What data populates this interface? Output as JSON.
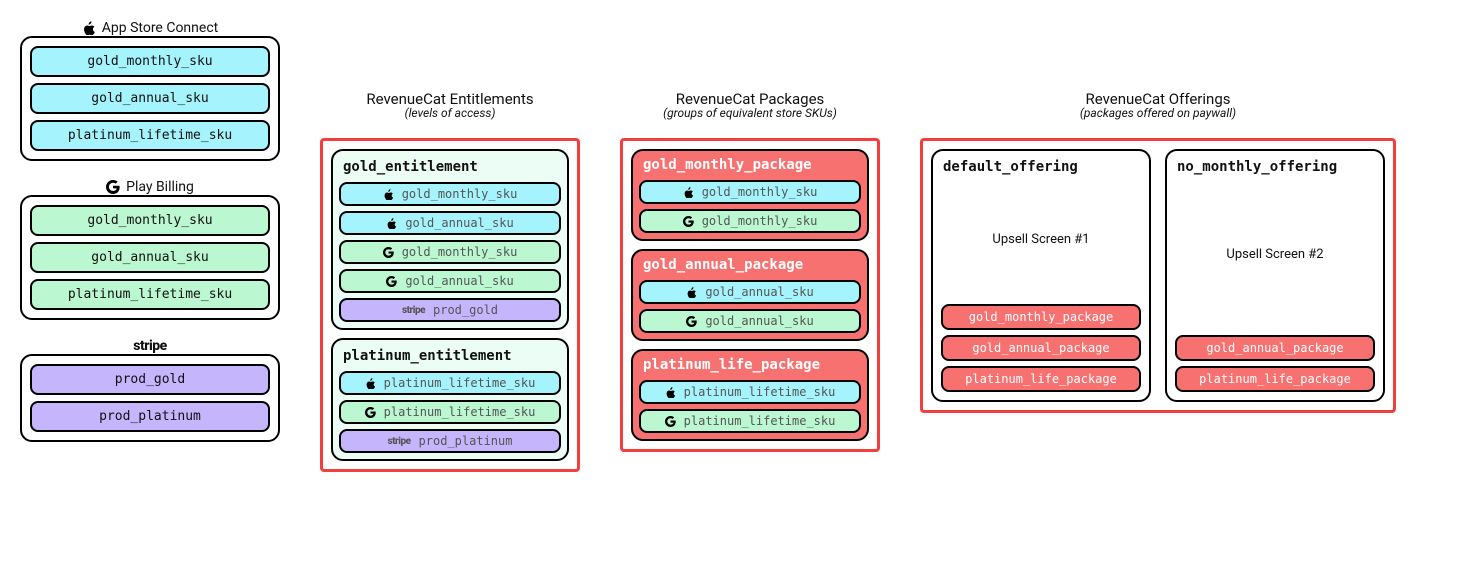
{
  "stores": {
    "apple": {
      "title": "App Store Connect",
      "skus": [
        "gold_monthly_sku",
        "gold_annual_sku",
        "platinum_lifetime_sku"
      ]
    },
    "google": {
      "title": "Play Billing",
      "skus": [
        "gold_monthly_sku",
        "gold_annual_sku",
        "platinum_lifetime_sku"
      ]
    },
    "stripe": {
      "title": "stripe",
      "skus": [
        "prod_gold",
        "prod_platinum"
      ]
    }
  },
  "entitlements": {
    "title": "RevenueCat Entitlements",
    "subtitle": "(levels of access)",
    "items": [
      {
        "name": "gold_entitlement",
        "skus": [
          {
            "store": "apple",
            "sku": "gold_monthly_sku"
          },
          {
            "store": "apple",
            "sku": "gold_annual_sku"
          },
          {
            "store": "google",
            "sku": "gold_monthly_sku"
          },
          {
            "store": "google",
            "sku": "gold_annual_sku"
          },
          {
            "store": "stripe",
            "sku": "prod_gold"
          }
        ]
      },
      {
        "name": "platinum_entitlement",
        "skus": [
          {
            "store": "apple",
            "sku": "platinum_lifetime_sku"
          },
          {
            "store": "google",
            "sku": "platinum_lifetime_sku"
          },
          {
            "store": "stripe",
            "sku": "prod_platinum"
          }
        ]
      }
    ]
  },
  "packages": {
    "title": "RevenueCat Packages",
    "subtitle": "(groups of equivalent store SKUs)",
    "items": [
      {
        "name": "gold_monthly_package",
        "skus": [
          {
            "store": "apple",
            "sku": "gold_monthly_sku"
          },
          {
            "store": "google",
            "sku": "gold_monthly_sku"
          }
        ]
      },
      {
        "name": "gold_annual_package",
        "skus": [
          {
            "store": "apple",
            "sku": "gold_annual_sku"
          },
          {
            "store": "google",
            "sku": "gold_annual_sku"
          }
        ]
      },
      {
        "name": "platinum_life_package",
        "skus": [
          {
            "store": "apple",
            "sku": "platinum_lifetime_sku"
          },
          {
            "store": "google",
            "sku": "platinum_lifetime_sku"
          }
        ]
      }
    ]
  },
  "offerings": {
    "title": "RevenueCat Offerings",
    "subtitle": "(packages offered on paywall)",
    "items": [
      {
        "name": "default_offering",
        "upsell": "Upsell Screen #1",
        "packages": [
          "gold_monthly_package",
          "gold_annual_package",
          "platinum_life_package"
        ]
      },
      {
        "name": "no_monthly_offering",
        "upsell": "Upsell Screen #2",
        "packages": [
          "gold_annual_package",
          "platinum_life_package"
        ]
      }
    ]
  }
}
